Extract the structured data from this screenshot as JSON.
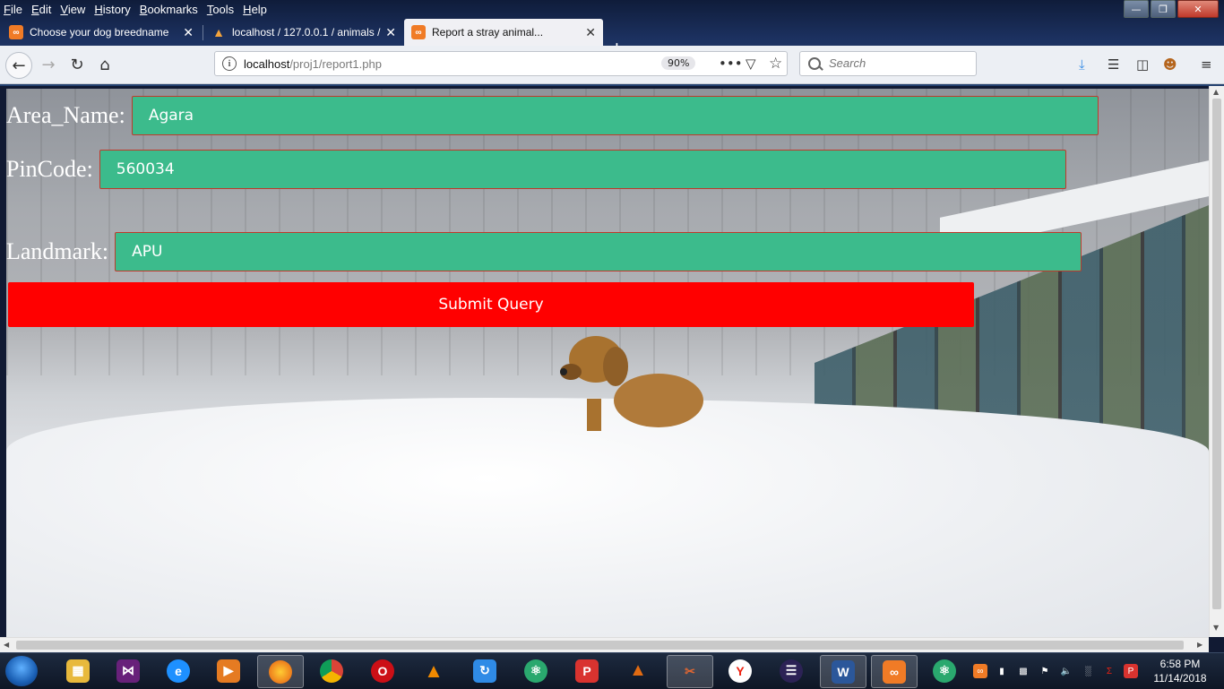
{
  "menubar": {
    "items": [
      "File",
      "Edit",
      "View",
      "History",
      "Bookmarks",
      "Tools",
      "Help"
    ]
  },
  "tabs": [
    {
      "label": "Choose your dog breedname",
      "icon": "xampp-icon",
      "active": false
    },
    {
      "label": "localhost / 127.0.0.1 / animals /",
      "icon": "phpmyadmin-icon",
      "active": false
    },
    {
      "label": "Report a stray animal...",
      "icon": "xampp-icon",
      "active": true
    }
  ],
  "navbar": {
    "url_host": "localhost",
    "url_path": "/proj1/report1.php",
    "zoom": "90%",
    "search_placeholder": "Search"
  },
  "form": {
    "area_label": "Area_Name:",
    "area_value": "Agara",
    "pincode_label": "PinCode:",
    "pincode_value": "560034",
    "landmark_label": "Landmark:",
    "landmark_value": "APU",
    "submit_label": "Submit Query"
  },
  "colors": {
    "input_bg": "#3cbb8c",
    "input_border": "#c0392b",
    "submit_bg": "#ff0000"
  },
  "taskbar": {
    "apps": [
      "file-explorer-icon",
      "visual-studio-icon",
      "internet-explorer-icon",
      "media-player-icon",
      "firefox-icon",
      "chrome-icon",
      "opera-icon",
      "vlc-icon",
      "sync-icon",
      "atom-icon",
      "psiphon-icon",
      "matlab-icon",
      "snipping-tool-icon",
      "yandex-icon",
      "eclipse-icon",
      "word-icon",
      "xampp-icon",
      "atom-icon"
    ],
    "time": "6:58 PM",
    "date": "11/14/2018"
  }
}
